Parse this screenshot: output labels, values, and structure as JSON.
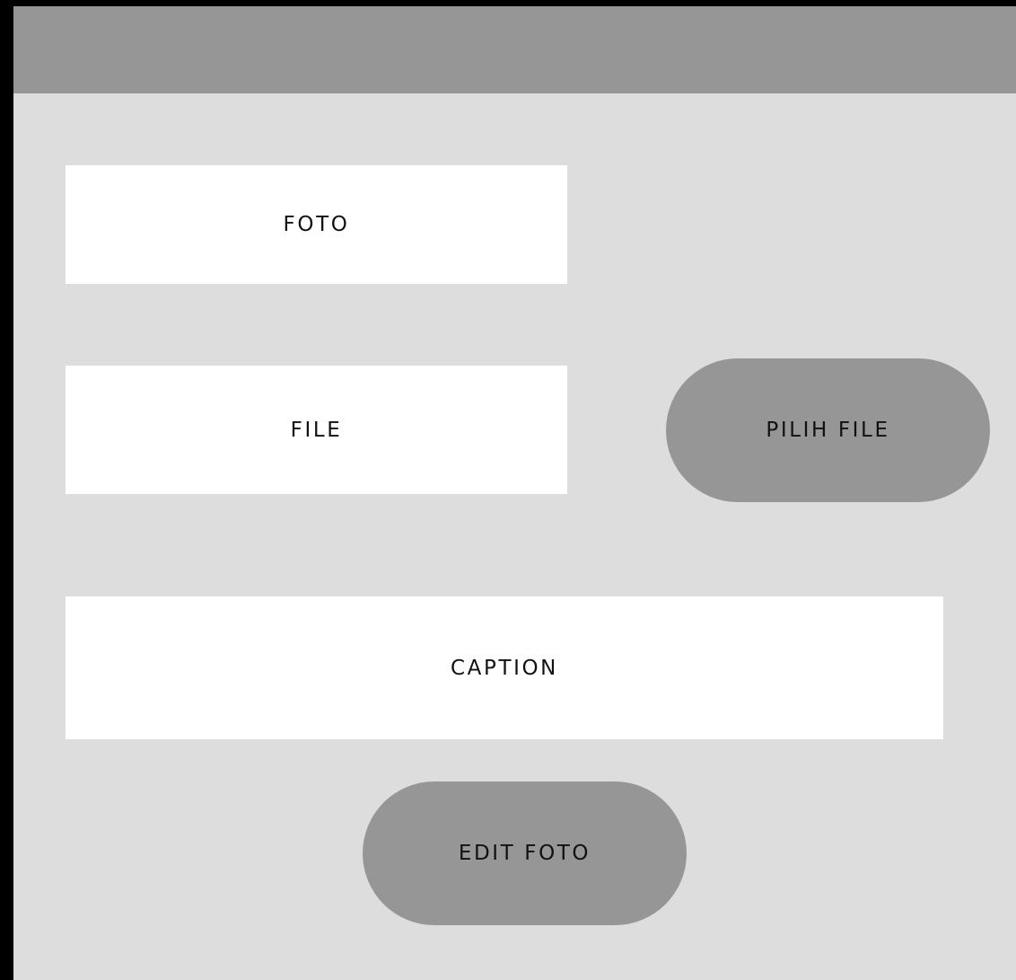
{
  "form": {
    "foto_label": "FOTO",
    "file_label": "FILE",
    "caption_label": "CAPTION"
  },
  "buttons": {
    "pilih_file_label": "PILIH FILE",
    "edit_foto_label": "EDIT FOTO"
  },
  "colors": {
    "header": "#969696",
    "background": "#DDDDDD",
    "field": "#FFFFFF",
    "button": "#969696",
    "frame": "#000000"
  }
}
